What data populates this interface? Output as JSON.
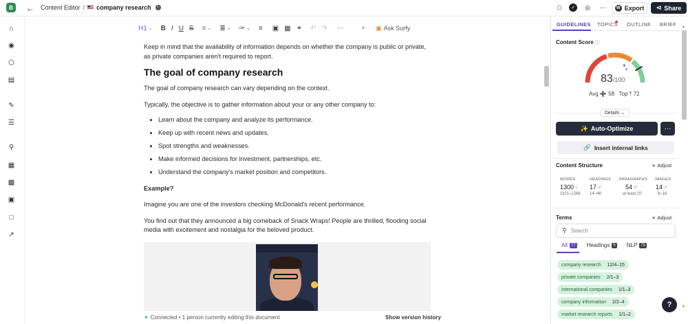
{
  "app": {
    "logo_letter": "B"
  },
  "breadcrumb": {
    "parent": "Content Editor",
    "separator": "/",
    "current": "company research"
  },
  "header": {
    "export_label": "Export",
    "share_label": "Share"
  },
  "toolbar": {
    "heading_label": "H1",
    "ask_label": "Ask Surfy"
  },
  "editor": {
    "para1": "Keep in mind that the availability of information depends on whether the company is public or private, as private companies aren't required to report.",
    "heading": "The goal of company research",
    "para2": "The goal of company research can vary depending on the context.",
    "para3": "Typically, the objective is to gather information about your or any other company to:",
    "bullets": [
      "Learn about the company and analyze its performance.",
      "Keep up with recent news and updates.",
      "Spot strengths and weaknesses.",
      "Make informed decisions for investment, partnerships, etc.",
      "Understand the company's market position and competitors."
    ],
    "example_label": "Example?",
    "para4": "Imagine you are one of the investors checking McDonald's recent performance.",
    "para5": "You find out that they announced a big comeback of Snack Wraps! People are thrilled, flooding social media with excitement and nostalgia for the beloved product.",
    "status_text": "Connected • 1 person currently editing this document",
    "version_history": "Show version history"
  },
  "panel": {
    "tabs": [
      "GUIDELINES",
      "TOPICS",
      "OUTLINE",
      "BRIEF"
    ],
    "content_score_label": "Content Score",
    "score_value": "83",
    "score_max": "/100",
    "avg_label": "Avg",
    "avg_value": "58",
    "top_label": "Top",
    "top_value": "72",
    "details_label": "Details",
    "auto_optimize_label": "Auto-Optimize",
    "internal_links_label": "Insert internal links",
    "structure_title": "Content Structure",
    "adjust_label": "Adjust",
    "stats": [
      {
        "label": "WORDS",
        "value": "1300",
        "range": "1101–1266",
        "status": "down"
      },
      {
        "label": "HEADINGS",
        "value": "17",
        "range": "14–46",
        "status": "ok"
      },
      {
        "label": "PARAGRAPHS",
        "value": "54",
        "range": "at least 20",
        "status": "ok"
      },
      {
        "label": "IMAGES",
        "value": "14",
        "range": "8–16",
        "status": "ok"
      }
    ],
    "terms_title": "Terms",
    "search_placeholder": "Search",
    "term_tabs": [
      {
        "label": "All",
        "count": "77"
      },
      {
        "label": "Headings",
        "count": "5"
      },
      {
        "label": "NLP",
        "count": "75"
      }
    ],
    "terms": [
      {
        "name": "company research",
        "count": "12/4–15"
      },
      {
        "name": "private companies",
        "count": "2/1–3"
      },
      {
        "name": "international companies",
        "count": "1/1–3"
      },
      {
        "name": "company information",
        "count": "2/2–4"
      },
      {
        "name": "market research reports",
        "count": "1/1–2"
      }
    ],
    "score_fraction": 0.83,
    "colors": {
      "accent": "#5b3fc4",
      "gauge_red": "#e0443a",
      "gauge_orange": "#e88a3a",
      "gauge_green": "#7fcf9a"
    }
  }
}
